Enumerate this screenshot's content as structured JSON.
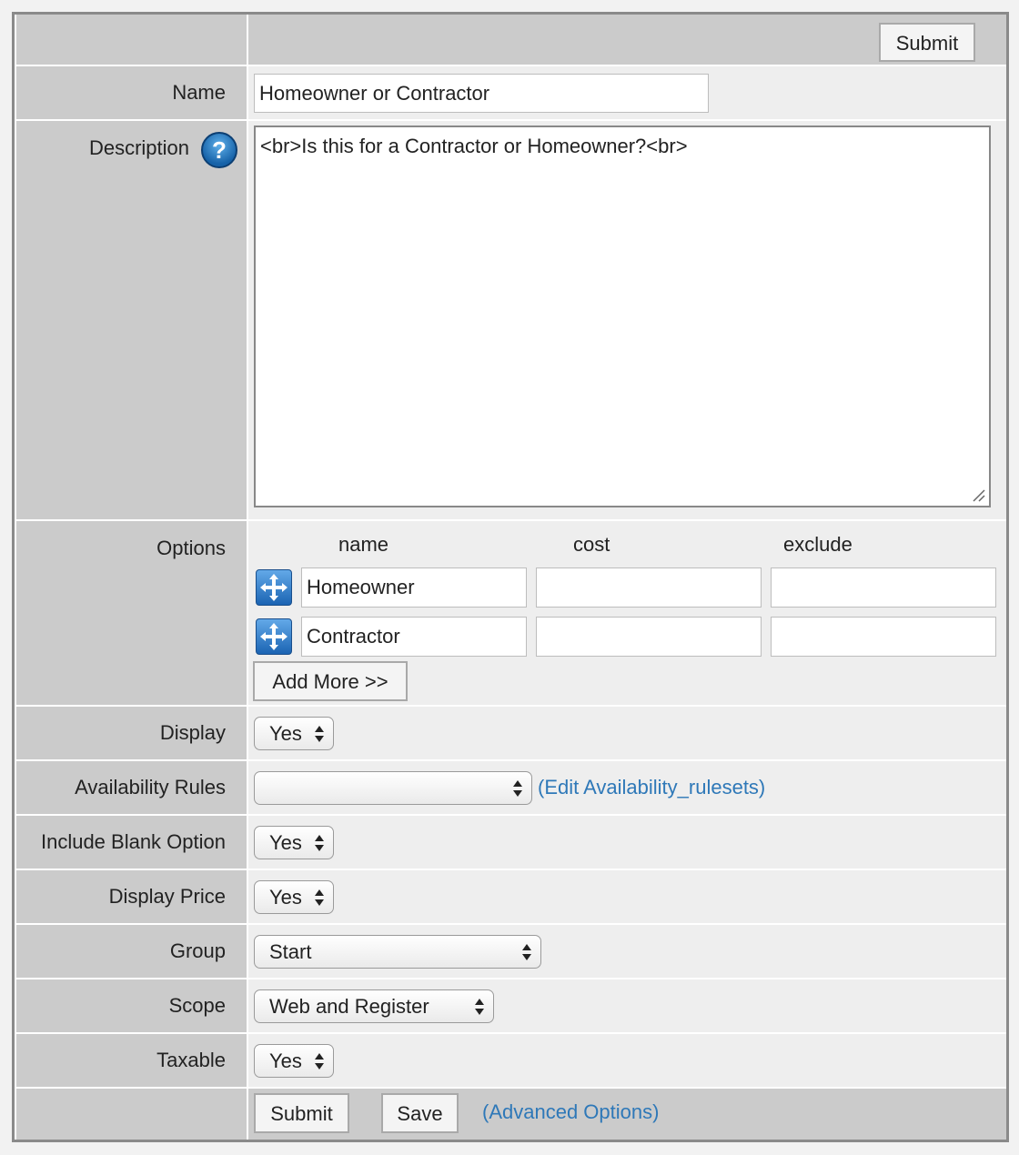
{
  "top": {
    "submit_label": "Submit"
  },
  "name": {
    "label": "Name",
    "value": "Homeowner or Contractor"
  },
  "description": {
    "label": "Description",
    "help_glyph": "?",
    "value": "<br>Is this for a Contractor or Homeowner?<br>"
  },
  "options": {
    "label": "Options",
    "headers": {
      "name": "name",
      "cost": "cost",
      "exclude": "exclude"
    },
    "rows": [
      {
        "name": "Homeowner",
        "cost": "",
        "exclude": ""
      },
      {
        "name": "Contractor",
        "cost": "",
        "exclude": ""
      }
    ],
    "add_more_label": "Add More >>"
  },
  "display": {
    "label": "Display",
    "value": "Yes"
  },
  "availability": {
    "label": "Availability Rules",
    "value": "",
    "edit_link": "(Edit Availability_rulesets)"
  },
  "include_blank": {
    "label": "Include Blank Option",
    "value": "Yes"
  },
  "display_price": {
    "label": "Display Price",
    "value": "Yes"
  },
  "group": {
    "label": "Group",
    "value": "Start"
  },
  "scope": {
    "label": "Scope",
    "value": "Web and Register"
  },
  "taxable": {
    "label": "Taxable",
    "value": "Yes"
  },
  "footer": {
    "submit_label": "Submit",
    "save_label": "Save",
    "advanced_link": "(Advanced Options)"
  },
  "icons": {
    "move": "move-arrows-icon",
    "help": "help-question-icon"
  },
  "colors": {
    "label_bg": "#cbcbcb",
    "value_bg": "#eeeeee",
    "link": "#2e78b8",
    "icon_blue": "#1b64b3"
  }
}
